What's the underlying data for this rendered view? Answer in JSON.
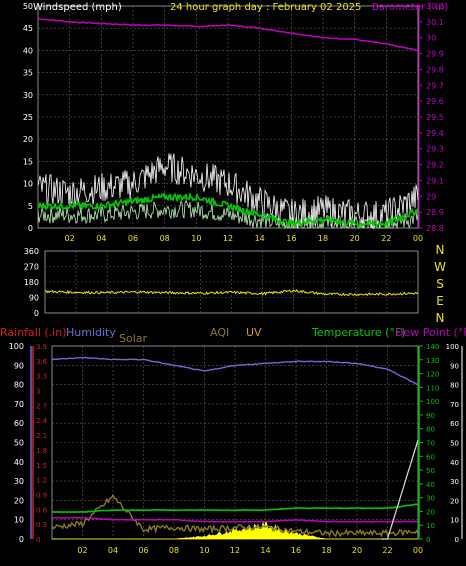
{
  "colors": {
    "background": "#000000",
    "plot_bg": "#000000",
    "grid": "#5a5a5a",
    "wind_avg": "#00c800",
    "wind_gust": "#ffffff",
    "wind_light": "#b8f0b8",
    "barometer": "#c000c0",
    "direction": "#e6e600",
    "humidity": "#6a6ad8",
    "temperature": "#00c800",
    "dewpoint": "#c000c0",
    "solar": "#ffff00",
    "aqi": "#8a7a20",
    "uv": "#d0a000",
    "rain_axis": "#d02020",
    "temp_axis": "#00c000"
  },
  "top_chart": {
    "title": "24 hour graph day : February 02 2025",
    "left_label": "Windspeed (mph)",
    "right_label": "Barometer ( in)",
    "y_left_ticks": [
      "50",
      "45",
      "40",
      "35",
      "30",
      "25",
      "20",
      "15",
      "10",
      "5",
      "0"
    ],
    "y_right_ticks": [
      "30.2",
      "30.1",
      "30",
      "29.9",
      "29.8",
      "29.7",
      "29.6",
      "29.5",
      "29.4",
      "29.3",
      "29.2",
      "29.1",
      "29",
      "28.9",
      "28.8"
    ],
    "x_ticks": [
      "02",
      "04",
      "06",
      "08",
      "10",
      "12",
      "14",
      "16",
      "18",
      "20",
      "22",
      "00"
    ]
  },
  "dir_chart": {
    "y_ticks": [
      "360",
      "270",
      "180",
      "90",
      "0"
    ],
    "compass": [
      "N",
      "W",
      "S",
      "E",
      "N"
    ]
  },
  "bottom_chart": {
    "legend": {
      "rainfall": "Rainfall (.in)",
      "humidity": "Humidity",
      "solar": "Solar",
      "aqi": "AQI",
      "uv": "UV",
      "temperature": "Temperature (°F)",
      "dewpoint": "Dew Point (°F)"
    },
    "hum_ticks": [
      "100",
      "90",
      "80",
      "70",
      "60",
      "50",
      "40",
      "30",
      "20",
      "10",
      "0"
    ],
    "rain_ticks": [
      "3.9",
      "3.6",
      "3.3",
      "3",
      "2.7",
      "2.4",
      "2.1",
      "1.8",
      "1.5",
      "1.2",
      "0.9",
      "0.6",
      "0.3",
      "0"
    ],
    "temp_ticks": [
      "140",
      "130",
      "120",
      "110",
      "100",
      "90",
      "80",
      "70",
      "60",
      "50",
      "40",
      "30",
      "20",
      "10",
      "0"
    ],
    "right_ticks": [
      "100",
      "90",
      "80",
      "70",
      "60",
      "50",
      "40",
      "30",
      "20",
      "10",
      "0"
    ],
    "x_ticks": [
      "02",
      "04",
      "06",
      "08",
      "10",
      "12",
      "14",
      "16",
      "18",
      "20",
      "22",
      "00"
    ]
  },
  "chart_data": [
    {
      "type": "line",
      "title": "24 hour graph day : February 02 2025",
      "xlabel": "",
      "ylabel": "Windspeed (mph)",
      "y2label": "Barometer ( in)",
      "x": [
        "00",
        "02",
        "04",
        "06",
        "08",
        "10",
        "12",
        "14",
        "16",
        "18",
        "20",
        "22",
        "00"
      ],
      "ylim": [
        0,
        50
      ],
      "y2lim": [
        28.8,
        30.2
      ],
      "series": [
        {
          "name": "Barometer",
          "axis": "y2",
          "values": [
            30.12,
            30.1,
            30.09,
            30.08,
            30.08,
            30.07,
            30.08,
            30.06,
            30.03,
            30.0,
            29.99,
            29.96,
            29.92
          ]
        },
        {
          "name": "Wind gust",
          "values": [
            9,
            8,
            9,
            10,
            14,
            12,
            10,
            6,
            3,
            4,
            3,
            3,
            7
          ]
        },
        {
          "name": "Wind average",
          "values": [
            5,
            5,
            5,
            6,
            7,
            7,
            5,
            3,
            1,
            2,
            1,
            1,
            4
          ]
        }
      ],
      "grid": true
    },
    {
      "type": "line",
      "title": "",
      "ylabel": "",
      "x": [
        "00",
        "02",
        "04",
        "06",
        "08",
        "10",
        "12",
        "14",
        "16",
        "18",
        "20",
        "22",
        "00"
      ],
      "ylim": [
        0,
        360
      ],
      "series": [
        {
          "name": "Wind direction",
          "values": [
            125,
            120,
            118,
            122,
            118,
            115,
            120,
            112,
            130,
            110,
            108,
            110,
            115
          ]
        }
      ],
      "grid": true
    },
    {
      "type": "line",
      "title": "",
      "x": [
        "00",
        "02",
        "04",
        "06",
        "08",
        "10",
        "12",
        "14",
        "16",
        "18",
        "20",
        "22",
        "00"
      ],
      "ylim": [
        0,
        100
      ],
      "series": [
        {
          "name": "Humidity",
          "values": [
            93,
            94,
            93,
            93,
            90,
            87,
            90,
            91,
            92,
            92,
            91,
            88,
            80
          ]
        },
        {
          "name": "Temperature (°F)",
          "values": [
            14,
            14,
            15,
            15,
            15,
            15,
            15,
            15,
            16,
            16,
            16,
            16,
            18
          ]
        },
        {
          "name": "Dew Point (°F)",
          "values": [
            11,
            11,
            10,
            10,
            10,
            9,
            9,
            9,
            10,
            9,
            9,
            9,
            9
          ]
        },
        {
          "name": "Solar",
          "values": [
            0,
            0,
            0,
            0,
            0,
            1,
            3,
            5,
            2,
            0,
            0,
            0,
            0
          ]
        },
        {
          "name": "AQI",
          "values": [
            6,
            8,
            22,
            5,
            6,
            5,
            6,
            6,
            4,
            3,
            3,
            3,
            4
          ]
        },
        {
          "name": "Rainfall (.in)",
          "values": [
            0,
            0,
            0,
            0,
            0,
            0,
            0,
            0,
            0,
            0,
            0,
            0,
            0.4
          ]
        }
      ],
      "grid": true
    }
  ]
}
